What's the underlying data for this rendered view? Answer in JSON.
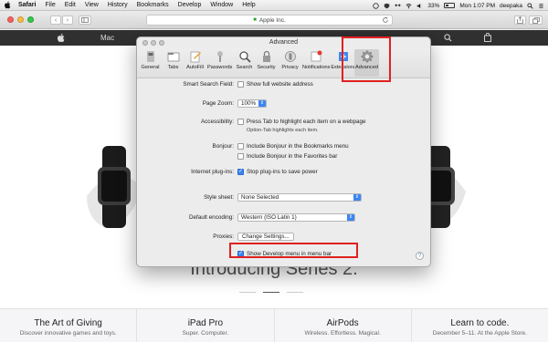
{
  "menubar": {
    "items": [
      "Safari",
      "File",
      "Edit",
      "View",
      "History",
      "Bookmarks",
      "Develop",
      "Window",
      "Help"
    ],
    "battery": "33%",
    "clock": "Mon 1:07 PM",
    "user": "deepaka"
  },
  "toolbar": {
    "address": "Apple Inc.",
    "back_glyph": "‹",
    "forward_glyph": "›"
  },
  "webnav": {
    "mac_label": "Mac"
  },
  "page": {
    "headline": "Introducing Series 2.",
    "promos": [
      {
        "title": "The Art of Giving",
        "subtitle": "Discover innovative games and toys."
      },
      {
        "title": "iPad Pro",
        "subtitle": "Super. Computer."
      },
      {
        "title": "AirPods",
        "subtitle": "Wireless. Effortless. Magical."
      },
      {
        "title": "Learn to code.",
        "subtitle": "December 5–11. At the Apple Store."
      }
    ]
  },
  "prefs": {
    "title": "Advanced",
    "tabs": [
      "General",
      "Tabs",
      "AutoFill",
      "Passwords",
      "Search",
      "Security",
      "Privacy",
      "Notifications",
      "Extensions",
      "Advanced"
    ],
    "active_tab": "Advanced",
    "smart_search_label": "Smart Search Field:",
    "smart_search_option": "Show full website address",
    "page_zoom_label": "Page Zoom:",
    "page_zoom_value": "100%",
    "accessibility_label": "Accessibility:",
    "accessibility_option": "Press Tab to highlight each item on a webpage",
    "accessibility_note": "Option-Tab highlights each item.",
    "bonjour_label": "Bonjour:",
    "bonjour_option_1": "Include Bonjour in the Bookmarks menu",
    "bonjour_option_2": "Include Bonjour in the Favorites bar",
    "plugins_label": "Internet plug-ins:",
    "plugins_option": "Stop plug-ins to save power",
    "stylesheet_label": "Style sheet:",
    "stylesheet_value": "None Selected",
    "encoding_label": "Default encoding:",
    "encoding_value": "Western (ISO Latin 1)",
    "proxies_label": "Proxies:",
    "proxies_button": "Change Settings...",
    "develop_option": "Show Develop menu in menu bar",
    "help_glyph": "?"
  },
  "colors": {
    "highlight": "#e02020",
    "checkbox_on": "#3a83f0"
  }
}
